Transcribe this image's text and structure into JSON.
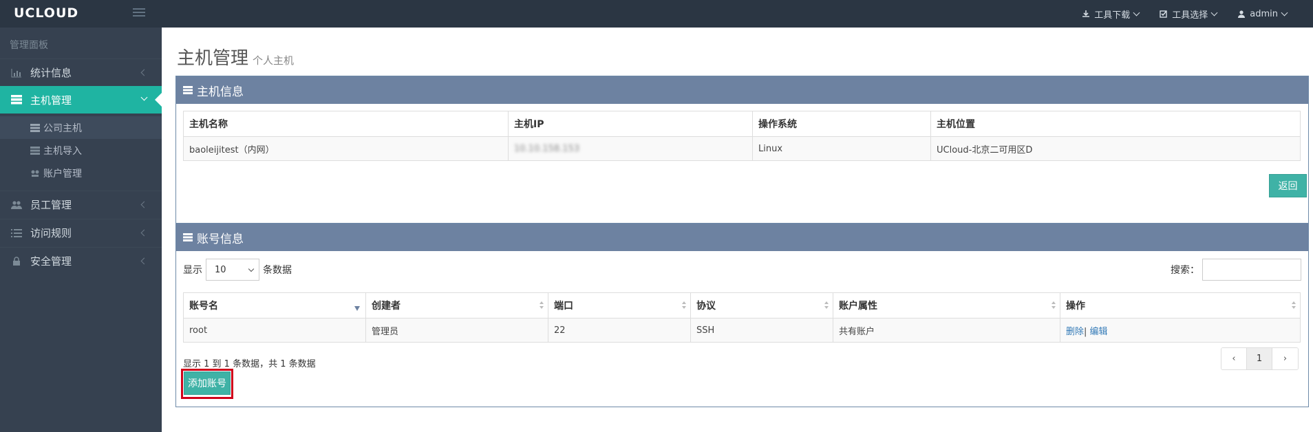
{
  "topbar": {
    "logo": "UCLOUD",
    "tools_download": "工具下载",
    "tools_select": "工具选择",
    "user": "admin"
  },
  "sidebar": {
    "title": "管理面板",
    "items": [
      {
        "label": "统计信息"
      },
      {
        "label": "主机管理"
      },
      {
        "label": "员工管理"
      },
      {
        "label": "访问规则"
      },
      {
        "label": "安全管理"
      }
    ],
    "subitems": [
      {
        "label": "公司主机"
      },
      {
        "label": "主机导入"
      },
      {
        "label": "账户管理"
      }
    ]
  },
  "page": {
    "title": "主机管理",
    "subtitle": "个人主机"
  },
  "host_info": {
    "header": "主机信息",
    "columns": [
      "主机名称",
      "主机IP",
      "操作系统",
      "主机位置"
    ],
    "row": {
      "name": "baoleijitest（内网）",
      "ip": "10.10.158.153",
      "os": "Linux",
      "location": "UCloud-北京二可用区D"
    },
    "back_label": "返回"
  },
  "account_info": {
    "header": "账号信息",
    "show_label": "显示",
    "page_size": "10",
    "records_label": "条数据",
    "search_label": "搜索：",
    "columns": [
      "账号名",
      "创建者",
      "端口",
      "协议",
      "账户属性",
      "操作"
    ],
    "row": {
      "account": "root",
      "creator": "管理员",
      "port": "22",
      "protocol": "SSH",
      "attribute": "共有账户",
      "delete": "删除",
      "sep": "|",
      "edit": "编辑"
    },
    "summary": "显示 1 到 1 条数据，共 1 条数据",
    "pager": {
      "prev": "‹",
      "current": "1",
      "next": "›"
    },
    "add_label": "添加账号"
  }
}
